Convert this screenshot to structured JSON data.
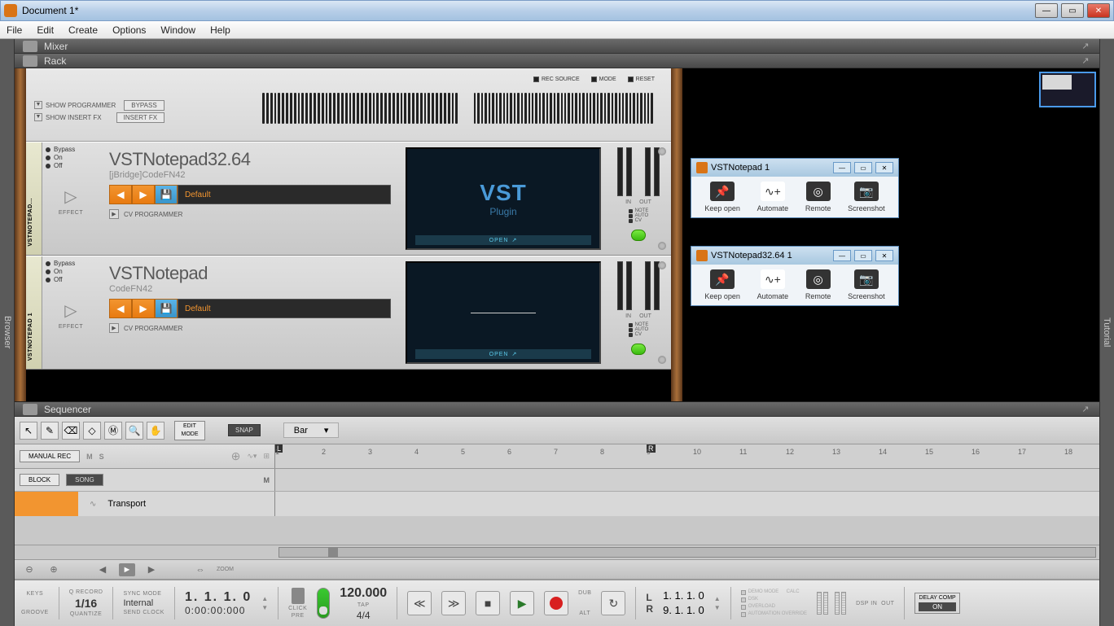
{
  "window": {
    "title": "Document 1*"
  },
  "menu": [
    "File",
    "Edit",
    "Create",
    "Options",
    "Window",
    "Help"
  ],
  "sections": {
    "mixer": "Mixer",
    "rack": "Rack",
    "sequencer": "Sequencer"
  },
  "side": {
    "browser": "Browser",
    "tutorial": "Tutorial"
  },
  "rackTop": {
    "recSource": "REC SOURCE",
    "mode": "MODE",
    "reset": "RESET",
    "showProgrammer": "SHOW PROGRAMMER",
    "showInsertFx": "SHOW INSERT FX",
    "bypass": "BYPASS",
    "insertFx": "INSERT FX"
  },
  "devices": [
    {
      "tab": "VSTNOTEPAD...",
      "title": "VSTNotepad32.64",
      "sub": "[jBridge]CodeFN42",
      "preset": "Default",
      "screenBig": "VST",
      "screenSm": "Plugin",
      "open": "OPEN",
      "cv": "CV PROGRAMMER",
      "effect": "EFFECT",
      "bypass": "Bypass",
      "on": "On",
      "off": "Off",
      "in": "IN",
      "out": "OUT",
      "note": "NOTE",
      "auto": "AUTO",
      "cvi": "CV"
    },
    {
      "tab": "VSTNOTEPAD 1",
      "title": "VSTNotepad",
      "sub": "CodeFN42",
      "preset": "Default",
      "screenBig": "",
      "screenSm": "",
      "open": "OPEN",
      "cv": "CV PROGRAMMER",
      "effect": "EFFECT",
      "bypass": "Bypass",
      "on": "On",
      "off": "Off",
      "in": "IN",
      "out": "OUT",
      "note": "NOTE",
      "auto": "AUTO",
      "cvi": "CV"
    }
  ],
  "popups": [
    {
      "title": "VSTNotepad 1",
      "items": [
        "Keep open",
        "Automate",
        "Remote",
        "Screenshot"
      ]
    },
    {
      "title": "VSTNotepad32.64 1",
      "items": [
        "Keep open",
        "Automate",
        "Remote",
        "Screenshot"
      ]
    }
  ],
  "seq": {
    "editMode": "EDIT MODE",
    "snap": "SNAP",
    "bar": "Bar",
    "manualRec": "MANUAL REC",
    "m": "M",
    "s": "S",
    "block": "BLOCK",
    "song": "SONG",
    "mute": "M",
    "transport": "Transport",
    "zoom": "ZOOM",
    "ruler": [
      1,
      2,
      3,
      4,
      5,
      6,
      7,
      8,
      9,
      10,
      11,
      12,
      13,
      14,
      15,
      16,
      17,
      18
    ],
    "L": "L",
    "R": "R"
  },
  "tb": {
    "keys": "KEYS",
    "groove": "GROOVE",
    "qrecord": "Q RECORD",
    "qval": "1/16",
    "quantize": "QUANTIZE",
    "syncMode": "SYNC MODE",
    "internal": "Internal",
    "sendClock": "SEND CLOCK",
    "pos": "1.  1.  1.    0",
    "time": "0:00:00:000",
    "click": "CLICK",
    "pre": "PRE",
    "tempo": "120.000",
    "tap": "TAP",
    "sig": "4/4",
    "dub": "DUB",
    "alt": "ALT",
    "loopL": "L",
    "loopR": "R",
    "loopPos1": "1.   1.   1.    0",
    "loopPos2": "9.   1.   1.    0",
    "delayComp": "DELAY COMP",
    "on": "ON",
    "dspIn": "DSP  IN",
    "dspOut": "OUT",
    "leds": [
      "DEMO MODE",
      "DSK",
      "OVERLOAD",
      "AUTOMATION OVERRIDE"
    ],
    "calc": "CALC"
  }
}
